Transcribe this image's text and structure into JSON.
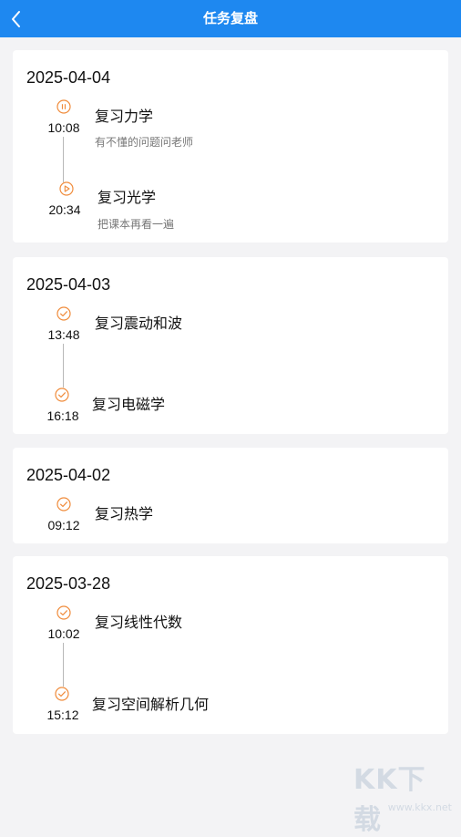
{
  "header": {
    "title": "任务复盘"
  },
  "colors": {
    "header_bg": "#1E88F0",
    "status_icon": "#F08C3C"
  },
  "groups": [
    {
      "date": "2025-04-04",
      "tasks": [
        {
          "time": "10:08",
          "name": "复习力学",
          "note": "有不懂的问题问老师",
          "status_icon": "pause-circle-icon"
        },
        {
          "time": "20:34",
          "name": "复习光学",
          "note": "把课本再看一遍",
          "status_icon": "play-circle-icon"
        }
      ]
    },
    {
      "date": "2025-04-03",
      "tasks": [
        {
          "time": "13:48",
          "name": "复习震动和波",
          "status_icon": "check-circle-icon"
        },
        {
          "time": "16:18",
          "name": "复习电磁学",
          "status_icon": "check-circle-icon"
        }
      ]
    },
    {
      "date": "2025-04-02",
      "tasks": [
        {
          "time": "09:12",
          "name": "复习热学",
          "status_icon": "check-circle-icon"
        }
      ]
    },
    {
      "date": "2025-03-28",
      "tasks": [
        {
          "time": "10:02",
          "name": "复习线性代数",
          "status_icon": "check-circle-icon"
        },
        {
          "time": "15:12",
          "name": "复习空间解析几何",
          "status_icon": "check-circle-icon"
        }
      ]
    }
  ],
  "watermark": {
    "logo": "KK下载",
    "url": "www.kkx.net"
  }
}
